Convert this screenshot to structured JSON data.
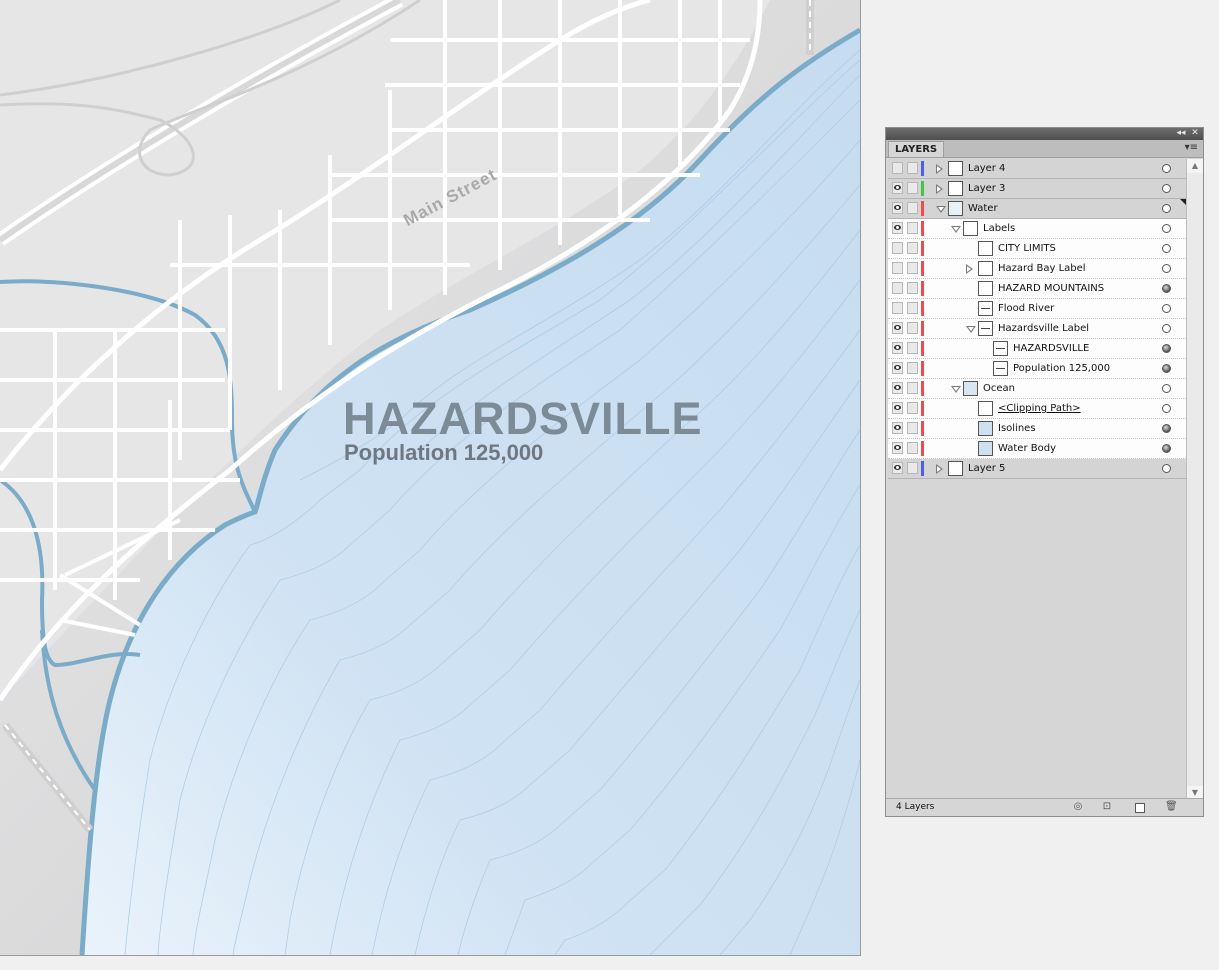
{
  "map": {
    "city_name": "HAZARDSVILLE",
    "population": "Population 125,000",
    "street_name": "Main Street"
  },
  "panel": {
    "tab_label": "LAYERS",
    "collapse_glyph": "◂◂",
    "close_glyph": "✕",
    "menu_glyph": "▾≡",
    "layer_count": "4 Layers",
    "footer_icons": [
      "locate-object-icon",
      "make-clipping-mask-icon",
      "create-sublayer-icon",
      "create-new-layer-icon",
      "delete-layer-icon"
    ]
  },
  "layers": [
    {
      "name": "Layer 4",
      "visible": false,
      "color": "#4f5de8",
      "level": 0,
      "disclosure": "right",
      "target": "hollow",
      "thumb": "plain",
      "kind": "top"
    },
    {
      "name": "Layer 3",
      "visible": true,
      "color": "#3fcb3f",
      "level": 0,
      "disclosure": "right",
      "target": "hollow",
      "thumb": "plain",
      "kind": "top"
    },
    {
      "name": "Water",
      "visible": true,
      "color": "#f04a4a",
      "level": 0,
      "disclosure": "down",
      "target": "hollow",
      "thumb": "water",
      "kind": "top"
    },
    {
      "name": "Labels",
      "visible": true,
      "color": "#f04a4a",
      "level": 1,
      "disclosure": "down",
      "target": "hollow",
      "thumb": "plain",
      "kind": "sub"
    },
    {
      "name": "CITY LIMITS",
      "visible": false,
      "color": "#f04a4a",
      "level": 2,
      "disclosure": "none",
      "target": "hollow",
      "thumb": "plain",
      "kind": "sub"
    },
    {
      "name": "Hazard Bay Label",
      "visible": false,
      "color": "#f04a4a",
      "level": 2,
      "disclosure": "right",
      "target": "hollow",
      "thumb": "plain",
      "kind": "sub"
    },
    {
      "name": "HAZARD   MOUNTAINS",
      "visible": false,
      "color": "#f04a4a",
      "level": 2,
      "disclosure": "none",
      "target": "filled",
      "thumb": "plain",
      "kind": "sub"
    },
    {
      "name": "Flood River",
      "visible": false,
      "color": "#f04a4a",
      "level": 2,
      "disclosure": "none",
      "target": "hollow",
      "thumb": "line",
      "kind": "sub"
    },
    {
      "name": "Hazardsville Label",
      "visible": true,
      "color": "#f04a4a",
      "level": 2,
      "disclosure": "down",
      "target": "hollow",
      "thumb": "line",
      "kind": "sub"
    },
    {
      "name": "HAZARDSVILLE",
      "visible": true,
      "color": "#f04a4a",
      "level": 3,
      "disclosure": "none",
      "target": "filled",
      "thumb": "line",
      "kind": "sub"
    },
    {
      "name": "Population 125,000",
      "visible": true,
      "color": "#f04a4a",
      "level": 3,
      "disclosure": "none",
      "target": "filled",
      "thumb": "line",
      "kind": "sub"
    },
    {
      "name": "Ocean",
      "visible": true,
      "color": "#f04a4a",
      "level": 1,
      "disclosure": "down",
      "target": "hollow",
      "thumb": "ocean",
      "kind": "sub"
    },
    {
      "name": "<Clipping Path>",
      "visible": true,
      "color": "#f04a4a",
      "level": 2,
      "disclosure": "none",
      "target": "hollow",
      "thumb": "plain",
      "kind": "sub",
      "underline": true
    },
    {
      "name": "Isolines",
      "visible": true,
      "color": "#f04a4a",
      "level": 2,
      "disclosure": "none",
      "target": "filled",
      "thumb": "blue",
      "kind": "sub"
    },
    {
      "name": "Water Body",
      "visible": true,
      "color": "#f04a4a",
      "level": 2,
      "disclosure": "none",
      "target": "filled",
      "thumb": "blue",
      "kind": "sub"
    },
    {
      "name": "Layer 5",
      "visible": true,
      "color": "#4f5de8",
      "level": 0,
      "disclosure": "right",
      "target": "hollow",
      "thumb": "plain",
      "kind": "top"
    }
  ]
}
